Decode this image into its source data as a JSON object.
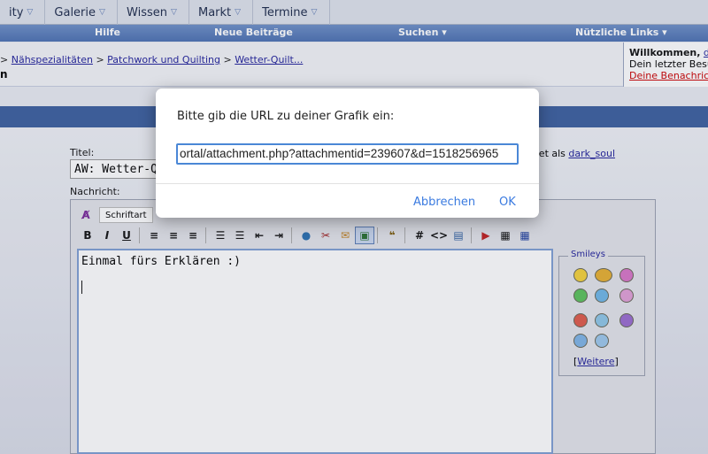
{
  "topnav": {
    "items": [
      {
        "label": "ity"
      },
      {
        "label": "Galerie"
      },
      {
        "label": "Wissen"
      },
      {
        "label": "Markt"
      },
      {
        "label": "Termine"
      }
    ]
  },
  "subnav": {
    "help": "Hilfe",
    "new_posts": "Neue Beiträge",
    "search": "Suchen ▾",
    "useful_links": "Nützliche Links ▾"
  },
  "breadcrumb": {
    "prefix": ">",
    "items": [
      "Nähspezialitäten",
      "Patchwork und Quilting",
      "Wetter-Quilt..."
    ],
    "heading": "n"
  },
  "welcome": {
    "greeting": "Willkommen,",
    "user_initial": "d",
    "last_visit": "Dein letzter Besu",
    "notifications": "Deine Benachrich"
  },
  "form": {
    "title_label": "Titel:",
    "title_value": "AW: Wetter-Qu",
    "logged_in_prefix": "eldet als",
    "username": "dark_soul",
    "message_label": "Nachricht:",
    "font_select": "Schriftart",
    "message_text": "Einmal fürs Erklären :)"
  },
  "toolbar": {
    "bold": "B",
    "italic": "I",
    "underline": "U",
    "hash": "#",
    "code": "<>"
  },
  "smileys": {
    "legend": "Smileys",
    "more": "Weitere",
    "more_prefix": "[",
    "more_suffix": "]"
  },
  "dialog": {
    "prompt": "Bitte gib die URL zu deiner Grafik ein:",
    "url_value": "ortal/attachment.php?attachmentid=239607&d=1518256965",
    "cancel": "Abbrechen",
    "ok": "OK"
  },
  "colors": {
    "subnav": "#4c71b2",
    "band": "#3c5f9f",
    "dialog_accent": "#3b7be0",
    "link": "#22229b"
  }
}
